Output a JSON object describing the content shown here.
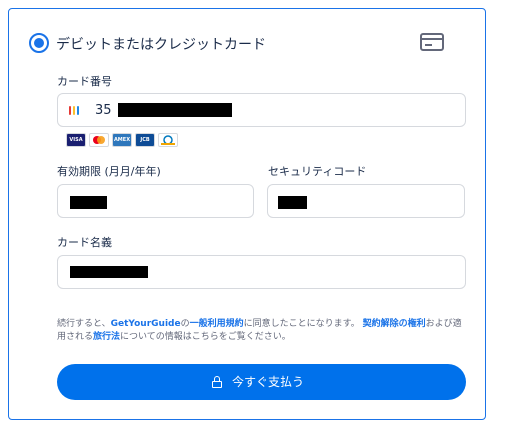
{
  "payment_method": {
    "label": "デビットまたはクレジットカード",
    "selected": true,
    "icon": "credit-card-icon"
  },
  "card_number": {
    "label": "カード番号",
    "visible_prefix": "35",
    "icon": "card-number-icon"
  },
  "accepted_brands": [
    {
      "name": "VISA",
      "color": "#1a1f71"
    },
    {
      "name": "Mastercard",
      "color": "#ffffff"
    },
    {
      "name": "American Express",
      "color": "#2e77bc"
    },
    {
      "name": "JCB",
      "color": "#0e4c96"
    },
    {
      "name": "Diners Club",
      "color": "#ffffff"
    }
  ],
  "expiry": {
    "label": "有効期限 (月月/年年)"
  },
  "security_code": {
    "label": "セキュリティコード"
  },
  "cardholder_name": {
    "label": "カード名義"
  },
  "terms": {
    "part1": "続行すると、",
    "link1": "GetYourGuide",
    "part2": "の",
    "link2": "一般利用規約",
    "part3": "に同意したことになります。",
    "link3": "契約解除の権利",
    "part4": "および適用される",
    "link4": "旅行法",
    "part5": "についての情報はこちらをご覧ください。"
  },
  "pay_button": {
    "label": "今すぐ支払う",
    "icon": "lock-icon"
  },
  "colors": {
    "accent": "#1a73e8",
    "button": "#0071eb",
    "text": "#1a2b49",
    "muted": "#63687a",
    "border": "#d6d9de"
  }
}
